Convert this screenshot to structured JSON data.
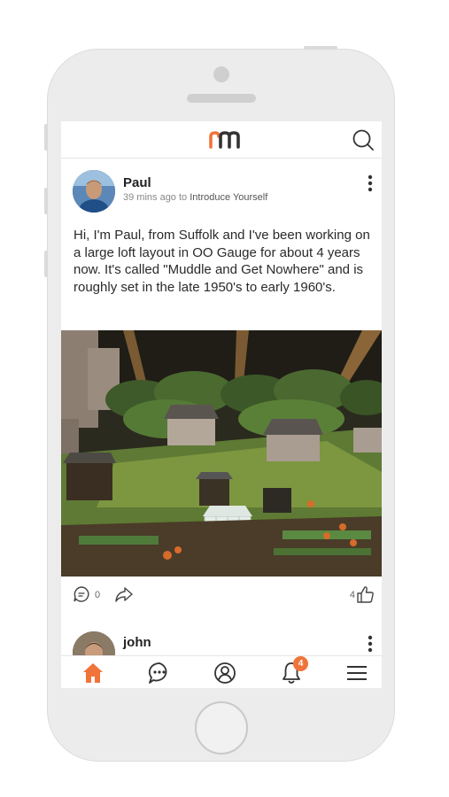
{
  "app": {
    "logo_label": "rm",
    "brand_colors": {
      "accent": "#f0743a",
      "dark": "#333333"
    }
  },
  "post": {
    "author": "Paul",
    "time_ago": "39 mins ago to",
    "forum": "Introduce Yourself",
    "body": "Hi, I'm Paul, from Suffolk and I've been working on a large loft layout in OO Gauge for about 4 years now. It's called \"Muddle and Get Nowhere\" and is roughly set in the late 1950's to early 1960's.",
    "image_description_icon": "photo",
    "comment_count": "0",
    "like_count": "4"
  },
  "next_post": {
    "author": "john"
  },
  "tabbar": {
    "items": [
      {
        "icon": "home-icon",
        "active": true
      },
      {
        "icon": "chat-icon",
        "active": false
      },
      {
        "icon": "profile-icon",
        "active": false
      },
      {
        "icon": "bell-icon",
        "active": false
      },
      {
        "icon": "menu-icon",
        "active": false
      }
    ],
    "notification_badge": "4"
  }
}
